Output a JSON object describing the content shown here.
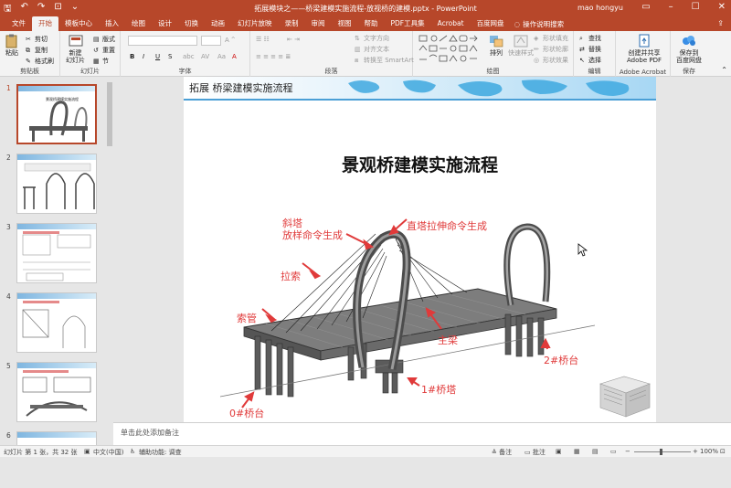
{
  "title_bar": {
    "document_title": "拓展模块之——桥梁建模实施流程-放视桥的建模.pptx  -  PowerPoint",
    "user_name": "mao hongyu"
  },
  "tabs": [
    "文件",
    "开始",
    "插入",
    "设计",
    "切换",
    "动画",
    "幻灯片放映",
    "录制",
    "审阅",
    "视图",
    "帮助",
    "PDF工具集",
    "Acrobat",
    "百度网盘"
  ],
  "tabs_display": [
    "文件",
    "开始",
    "模板中心",
    "插入",
    "绘图",
    "设计",
    "切换",
    "动画",
    "幻灯片放映",
    "录制",
    "审阅",
    "视图",
    "帮助",
    "PDF工具集",
    "Acrobat",
    "百度网盘"
  ],
  "active_tab": "开始",
  "tell_me": "操作说明搜索",
  "ribbon": {
    "clipboard": {
      "paste": "粘贴",
      "cut": "剪切",
      "copy": "复制",
      "format_painter": "格式刷",
      "label": "剪贴板"
    },
    "slides": {
      "new_slide": "新建\n幻灯片",
      "layout": "版式",
      "reset": "重置",
      "section": "节",
      "label": "幻灯片"
    },
    "font": {
      "bold": "B",
      "italic": "I",
      "underline": "U",
      "strike": "S",
      "label": "字体"
    },
    "paragraph": {
      "text_direction": "文字方向",
      "align_text": "对齐文本",
      "smartart": "转换至 SmartArt",
      "label": "段落"
    },
    "drawing": {
      "arrange": "排列",
      "quick_styles": "快速样式",
      "shape_fill": "形状填充",
      "shape_outline": "形状轮廓",
      "shape_effects": "形状效果",
      "label": "绘图"
    },
    "editing": {
      "find": "查找",
      "replace": "替换",
      "select": "选择",
      "label": "编辑"
    },
    "acrobat": {
      "create_share": "创建并共享\nAdobe PDF",
      "label": "Adobe Acrobat"
    },
    "save": {
      "save_baidu": "保存到\n百度网盘",
      "label": "保存"
    }
  },
  "thumbnails": [
    {
      "number": "1",
      "selected": true
    },
    {
      "number": "2",
      "selected": false
    },
    {
      "number": "3",
      "selected": false
    },
    {
      "number": "4",
      "selected": false
    },
    {
      "number": "5",
      "selected": false
    },
    {
      "number": "6",
      "selected": false
    }
  ],
  "slide": {
    "banner_title": "拓展  桥梁建模实施流程",
    "main_title": "景观桥建模实施流程",
    "annotations": {
      "slant_tower": "斜塔\n放样命令生成",
      "straight_tower": "直塔拉伸命令生成",
      "cable": "拉索",
      "cable_tube": "索管",
      "main_beam": "主梁",
      "pier2": "2#桥台",
      "tower1": "1#桥塔",
      "pier0": "0#桥台"
    }
  },
  "notes_placeholder": "单击此处添加备注",
  "status": {
    "slide_of": "幻灯片 第 1 张，共 32 张",
    "language": "中文(中国)",
    "accessibility": "辅助功能: 调查",
    "notes": "备注",
    "comments": "批注",
    "zoom": "100%"
  },
  "colors": {
    "accent": "#b7472a",
    "annotation": "#e03a3a"
  }
}
